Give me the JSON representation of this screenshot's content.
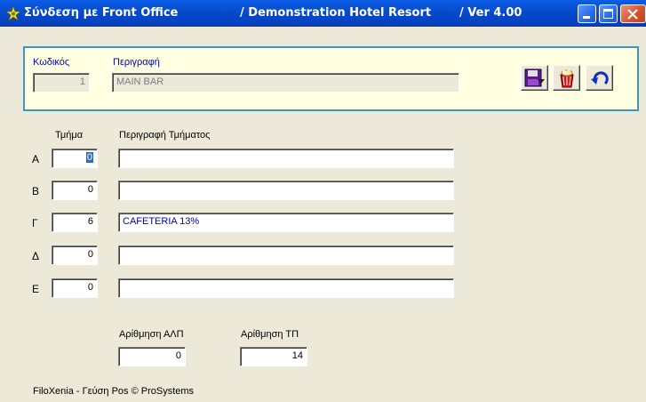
{
  "window": {
    "title_main": "Σύνδεση με Front Office",
    "title_hotel": "/ Demonstration Hotel Resort",
    "title_version": "/ Ver  4.00"
  },
  "header": {
    "code_label": "Κωδικός",
    "description_label": "Περιγραφή",
    "code_value": "1",
    "description_value": "MAIN BAR"
  },
  "toolbar": {
    "save": "save-icon",
    "delete": "delete-icon",
    "undo": "undo-icon"
  },
  "departments": {
    "column_dept": "Τμήμα",
    "column_desc": "Περιγραφή Τμήματος",
    "rows": [
      {
        "letter": "Α",
        "value": "0",
        "desc": ""
      },
      {
        "letter": "Β",
        "value": "0",
        "desc": ""
      },
      {
        "letter": "Γ",
        "value": "6",
        "desc": "CAFETERIA 13%"
      },
      {
        "letter": "Δ",
        "value": "0",
        "desc": ""
      },
      {
        "letter": "Ε",
        "value": "0",
        "desc": ""
      }
    ]
  },
  "numbering": {
    "alp_label": "Αρίθμηση ΑΛΠ",
    "alp_value": "0",
    "tp_label": "Αρίθμηση ΤΠ",
    "tp_value": "14"
  },
  "footer": "FiloXenia - Γεύση Pos  © ProSystems",
  "colors": {
    "titlebar": "#0548c9",
    "window_bg": "#ece9d8",
    "panel_bg": "#ffffe1",
    "panel_border": "#3f95c0",
    "label_blue": "#0000c0"
  }
}
